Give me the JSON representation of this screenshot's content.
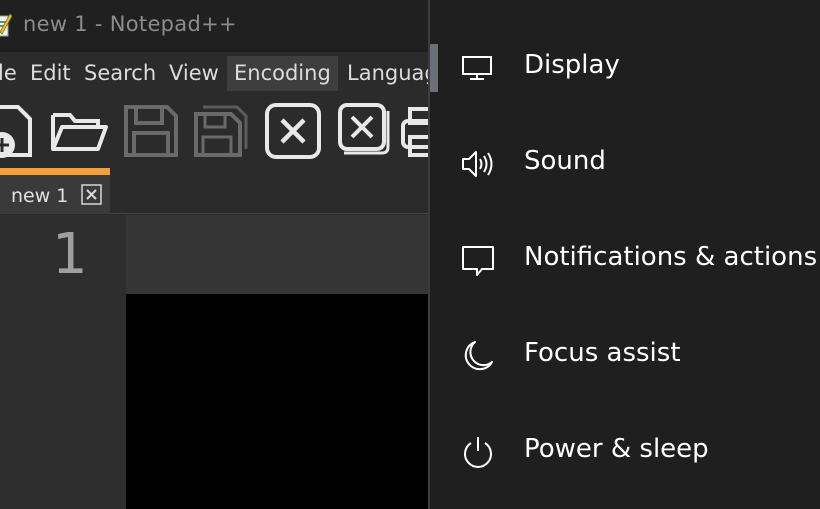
{
  "notepad": {
    "window_title": "new 1 - Notepad++",
    "menu": [
      {
        "label": "le"
      },
      {
        "label": "Edit"
      },
      {
        "label": "Search"
      },
      {
        "label": "View"
      },
      {
        "label": "Encoding"
      },
      {
        "label": "Languag"
      }
    ],
    "active_menu": "Encoding",
    "toolbar_icons": [
      "new-file-icon",
      "open-folder-icon",
      "save-icon",
      "save-all-icon",
      "close-icon",
      "close-all-icon",
      "print-icon"
    ],
    "tab": {
      "label": "new 1"
    },
    "line_number": "1"
  },
  "settings": {
    "items": [
      {
        "label": "Display",
        "icon": "monitor-icon"
      },
      {
        "label": "Sound",
        "icon": "speaker-icon"
      },
      {
        "label": "Notifications & actions",
        "icon": "notification-icon"
      },
      {
        "label": "Focus assist",
        "icon": "moon-icon"
      },
      {
        "label": "Power & sleep",
        "icon": "power-icon"
      }
    ]
  },
  "colors": {
    "tab_accent": "#f6a03c",
    "settings_bg": "#1f1f1f",
    "editor_bg": "#000000"
  }
}
